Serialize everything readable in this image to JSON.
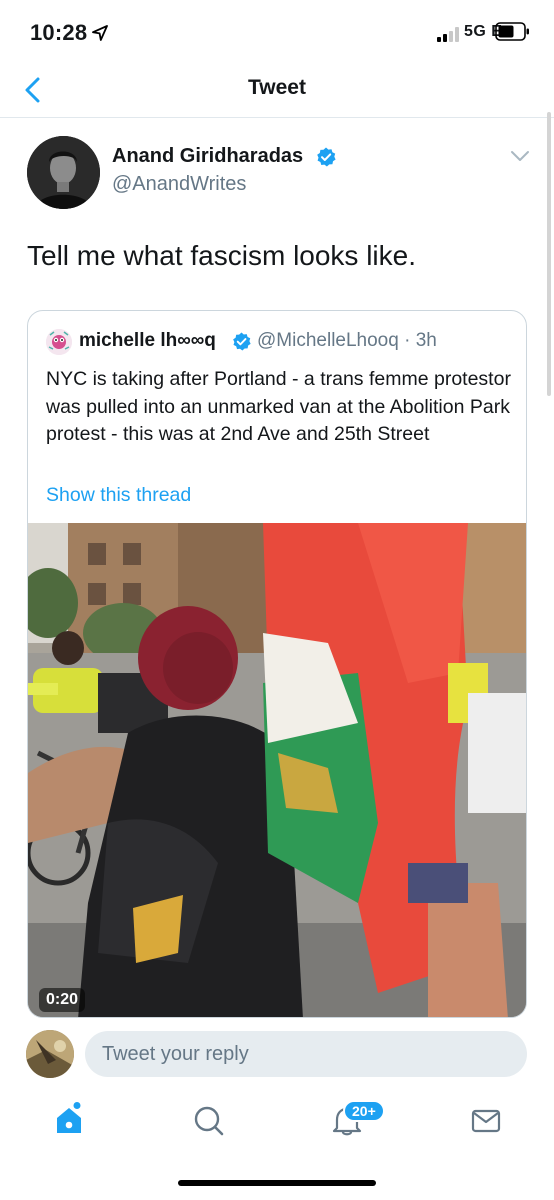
{
  "status_bar": {
    "time": "10:28",
    "network": "5G E"
  },
  "nav": {
    "title": "Tweet"
  },
  "tweet": {
    "author_name": "Anand Giridharadas",
    "author_handle": "@AnandWrites",
    "text": "Tell me what fascism looks like."
  },
  "quoted_tweet": {
    "author_name": "michelle lh∞∞q",
    "author_handle": "@MichelleLhooq",
    "time": "3h",
    "text": "NYC is taking after Portland - a trans femme protestor was pulled into an unmarked van at the Abolition Park protest - this was at 2nd Ave and 25th Street",
    "show_thread": "Show this thread",
    "video_duration": "0:20"
  },
  "reply": {
    "placeholder": "Tweet your reply"
  },
  "tab_bar": {
    "notifications_badge": "20+",
    "icons": [
      "home-icon",
      "search-icon",
      "notifications-bell-icon",
      "messages-envelope-icon"
    ]
  },
  "colors": {
    "accent": "#1da1f2",
    "secondary_text": "#657786",
    "border": "#ccd6dd"
  }
}
